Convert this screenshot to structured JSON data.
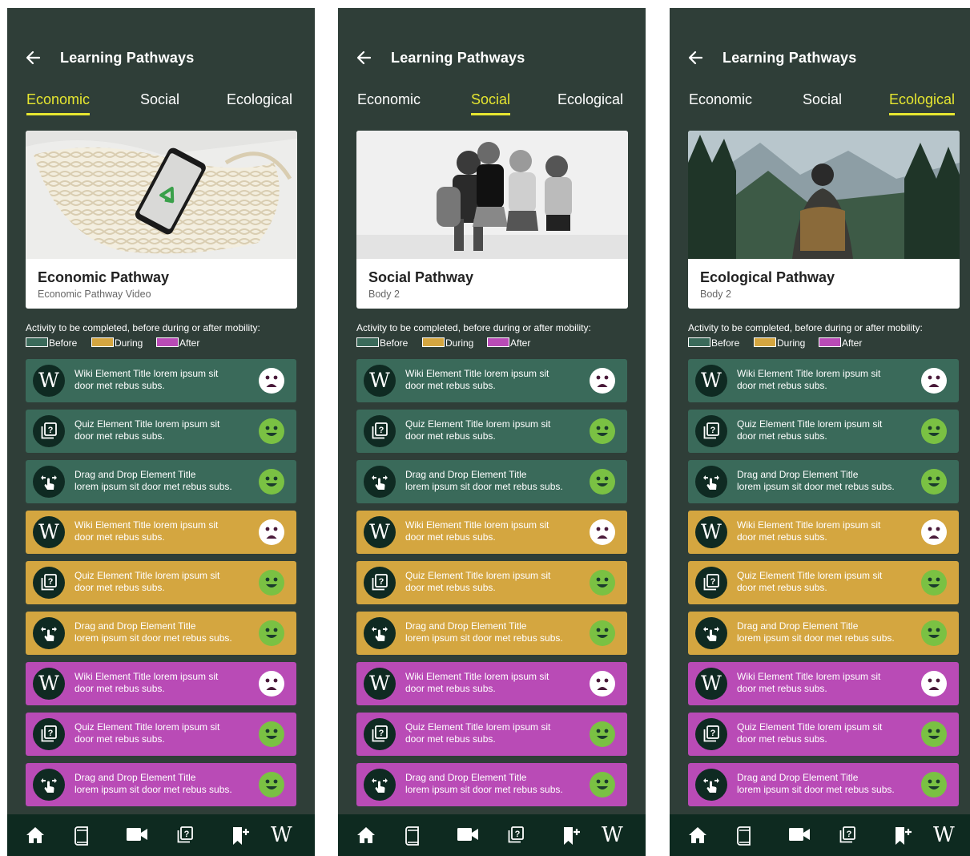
{
  "screens": [
    {
      "header_title": "Learning Pathways",
      "tabs": [
        "Economic",
        "Social",
        "Ecological"
      ],
      "active_tab": 0,
      "card": {
        "title": "Economic Pathway",
        "subtitle": "Economic Pathway Video",
        "image": "recycling-phone-mesh-bag"
      },
      "activity_text": "Activity to be completed, before during or after mobility:",
      "legend": [
        {
          "label": "Before",
          "color": "#3a6a5a"
        },
        {
          "label": "During",
          "color": "#d4a640"
        },
        {
          "label": "After",
          "color": "#b94bb6"
        }
      ]
    },
    {
      "header_title": "Learning Pathways",
      "tabs": [
        "Economic",
        "Social",
        "Ecological"
      ],
      "active_tab": 1,
      "card": {
        "title": "Social Pathway",
        "subtitle": "Body 2",
        "image": "four-friends-laughing"
      },
      "activity_text": "Activity to be completed, before during or after mobility:",
      "legend": [
        {
          "label": "Before",
          "color": "#3a6a5a"
        },
        {
          "label": "During",
          "color": "#d4a640"
        },
        {
          "label": "After",
          "color": "#b94bb6"
        }
      ]
    },
    {
      "header_title": "Learning Pathways",
      "tabs": [
        "Economic",
        "Social",
        "Ecological"
      ],
      "active_tab": 2,
      "card": {
        "title": "Ecological Pathway",
        "subtitle": "Body 2",
        "image": "hiker-mountain-forest"
      },
      "activity_text": "Activity to be completed, before during or after mobility:",
      "legend": [
        {
          "label": "Before",
          "color": "#3a6a5a"
        },
        {
          "label": "During",
          "color": "#d4a640"
        },
        {
          "label": "After",
          "color": "#b94bb6"
        }
      ]
    }
  ],
  "activities": [
    {
      "type": "wiki",
      "icon": "wiki-icon",
      "line1": "Wiki Element Title lorem ipsum sit",
      "line2": "door met rebus subs.",
      "phase": "before",
      "mood": "sad"
    },
    {
      "type": "quiz",
      "icon": "quiz-icon",
      "line1": "Quiz Element Title lorem ipsum sit",
      "line2": "door met rebus subs.",
      "phase": "before",
      "mood": "happy"
    },
    {
      "type": "drag",
      "icon": "drag-drop-icon",
      "line1": "Drag and Drop Element Title",
      "line2": "lorem ipsum sit  door met rebus subs.",
      "phase": "before",
      "mood": "happy"
    },
    {
      "type": "wiki",
      "icon": "wiki-icon",
      "line1": "Wiki Element Title lorem ipsum sit",
      "line2": "door met rebus subs.",
      "phase": "during",
      "mood": "sad"
    },
    {
      "type": "quiz",
      "icon": "quiz-icon",
      "line1": "Quiz Element Title lorem ipsum sit",
      "line2": "door met rebus subs.",
      "phase": "during",
      "mood": "happy"
    },
    {
      "type": "drag",
      "icon": "drag-drop-icon",
      "line1": "Drag and Drop Element Title",
      "line2": "lorem ipsum sit  door met rebus subs.",
      "phase": "during",
      "mood": "happy"
    },
    {
      "type": "wiki",
      "icon": "wiki-icon",
      "line1": "Wiki Element Title lorem ipsum sit",
      "line2": "door met rebus subs.",
      "phase": "after",
      "mood": "sad"
    },
    {
      "type": "quiz",
      "icon": "quiz-icon",
      "line1": "Quiz Element Title lorem ipsum sit",
      "line2": "door met rebus subs.",
      "phase": "after",
      "mood": "happy"
    },
    {
      "type": "drag",
      "icon": "drag-drop-icon",
      "line1": "Drag and Drop Element Title",
      "line2": "lorem ipsum sit  door met rebus subs.",
      "phase": "after",
      "mood": "happy"
    }
  ],
  "phase_colors": {
    "before": "#3a6a5a",
    "during": "#d4a640",
    "after": "#b94bb6"
  },
  "mood_colors": {
    "happy": "#7ac143",
    "sad": "#ffffff"
  },
  "bottom_nav": [
    {
      "name": "home-icon"
    },
    {
      "name": "book-icon"
    },
    {
      "name": "video-icon"
    },
    {
      "name": "quiz-icon"
    },
    {
      "name": "bookmark-add-icon"
    },
    {
      "name": "wiki-icon",
      "glyph": "W"
    }
  ],
  "colors": {
    "screen_bg": "#2f3e38",
    "nav_bg": "#0e2a20",
    "accent": "#e6e630"
  }
}
